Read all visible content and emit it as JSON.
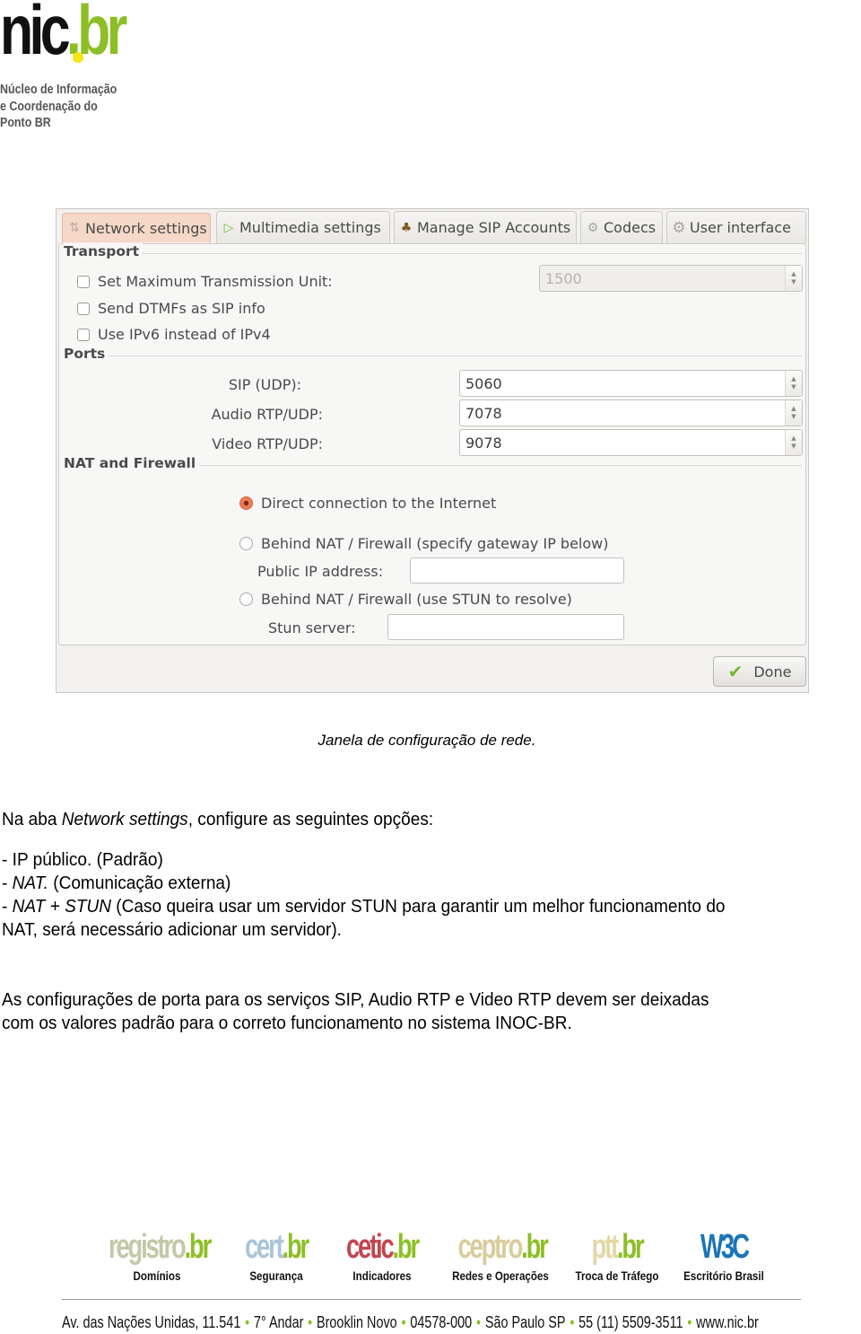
{
  "header": {
    "logo_main": "nic",
    "logo_suffix": ".br",
    "logo_subtitle": [
      "Núcleo de Informação",
      "e Coordenação do",
      "Ponto BR"
    ]
  },
  "dialog": {
    "tabs": [
      {
        "label": "Network settings",
        "icon": "network-icon",
        "active": true
      },
      {
        "label": "Multimedia settings",
        "icon": "play-icon",
        "active": false
      },
      {
        "label": "Manage SIP Accounts",
        "icon": "accounts-icon",
        "active": false
      },
      {
        "label": "Codecs",
        "icon": "gears-icon",
        "active": false
      },
      {
        "label": "User interface",
        "icon": "gear-icon",
        "active": false
      }
    ],
    "transport": {
      "title": "Transport",
      "options": [
        {
          "label": "Set Maximum Transmission Unit:",
          "checked": false
        },
        {
          "label": "Send DTMFs as SIP info",
          "checked": false
        },
        {
          "label": "Use IPv6 instead of IPv4",
          "checked": false
        }
      ],
      "mtu_value": "1500"
    },
    "ports": {
      "title": "Ports",
      "fields": [
        {
          "label": "SIP (UDP):",
          "value": "5060"
        },
        {
          "label": "Audio RTP/UDP:",
          "value": "7078"
        },
        {
          "label": "Video RTP/UDP:",
          "value": "9078"
        }
      ]
    },
    "nat": {
      "title": "NAT and Firewall",
      "options": [
        {
          "label": "Direct connection to the Internet",
          "checked": true
        },
        {
          "label": "Behind NAT / Firewall (specify gateway IP below)",
          "checked": false
        },
        {
          "label": "Behind NAT / Firewall (use STUN to resolve)",
          "checked": false
        }
      ],
      "public_ip_label": "Public IP address:",
      "public_ip_value": "",
      "stun_label": "Stun server:",
      "stun_value": ""
    },
    "done_label": "Done"
  },
  "document": {
    "caption": "Janela de configuração de rede.",
    "intro_prefix": "Na aba ",
    "intro_italic": "Network settings",
    "intro_suffix": ", configure as seguintes opções:",
    "item1": "- IP público. (Padrão)",
    "item2_prefix": "- ",
    "item2_italic": "NAT.",
    "item2_suffix": " (Comunicação externa)",
    "item3_prefix": "- ",
    "item3_italic": "NAT + STUN",
    "item3_suffix": " (Caso queira usar um servidor STUN para garantir um melhor funcionamento do",
    "item3_cont": "NAT, será necessário adicionar um servidor).",
    "ports_line1": "As configurações de porta para os serviços SIP, Audio RTP e Video RTP devem ser deixadas",
    "ports_line2": "com os valores padrão para o correto funcionamento no sistema INOC-BR."
  },
  "footer": {
    "partners": [
      {
        "name": "registro",
        "suffix": ".br",
        "desc": "Domínios",
        "color": "#c5c8a8"
      },
      {
        "name": "cert",
        "suffix": ".br",
        "desc": "Segurança",
        "color": "#a9c6d8"
      },
      {
        "name": "cetic",
        "suffix": ".br",
        "desc": "Indicadores",
        "color": "#c1464f"
      },
      {
        "name": "ceptro",
        "suffix": ".br",
        "desc": "Redes e Operações",
        "color": "#d9cc9c"
      },
      {
        "name": "ptt",
        "suffix": ".br",
        "desc": "Troca de Tráfego",
        "color": "#e3d8a6"
      },
      {
        "name": "W3C",
        "suffix": "",
        "desc": "Escritório Brasil",
        "color": "#1a75b6"
      }
    ],
    "address_parts": [
      "Av. das Nações Unidas, 11.541",
      "7° Andar",
      "Brooklin Novo",
      "04578-000",
      "São Paulo SP",
      "55 (11) 5509-3511",
      "www.nic.br"
    ],
    "separator": "•"
  }
}
